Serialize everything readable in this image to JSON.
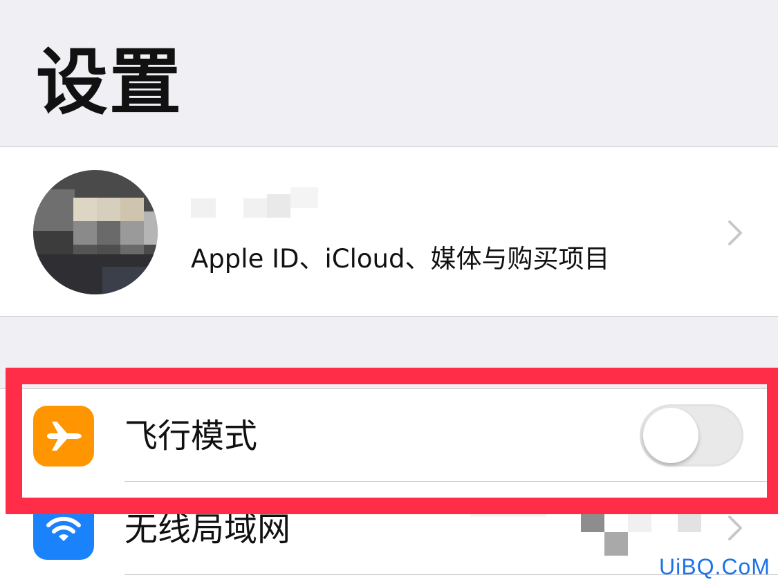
{
  "page": {
    "title": "设置"
  },
  "profile": {
    "subtitle": "Apple ID、iCloud、媒体与购买项目"
  },
  "settings": {
    "airplane": {
      "label": "飞行模式",
      "icon": "airplane-icon",
      "icon_color": "#ff9500",
      "toggle_on": false
    },
    "wifi": {
      "label": "无线局域网",
      "icon": "wifi-icon",
      "icon_color": "#1a82fb"
    }
  },
  "annotation": {
    "highlight_color": "#ff2d48"
  },
  "watermark": {
    "text": "UiBQ.CoM"
  }
}
